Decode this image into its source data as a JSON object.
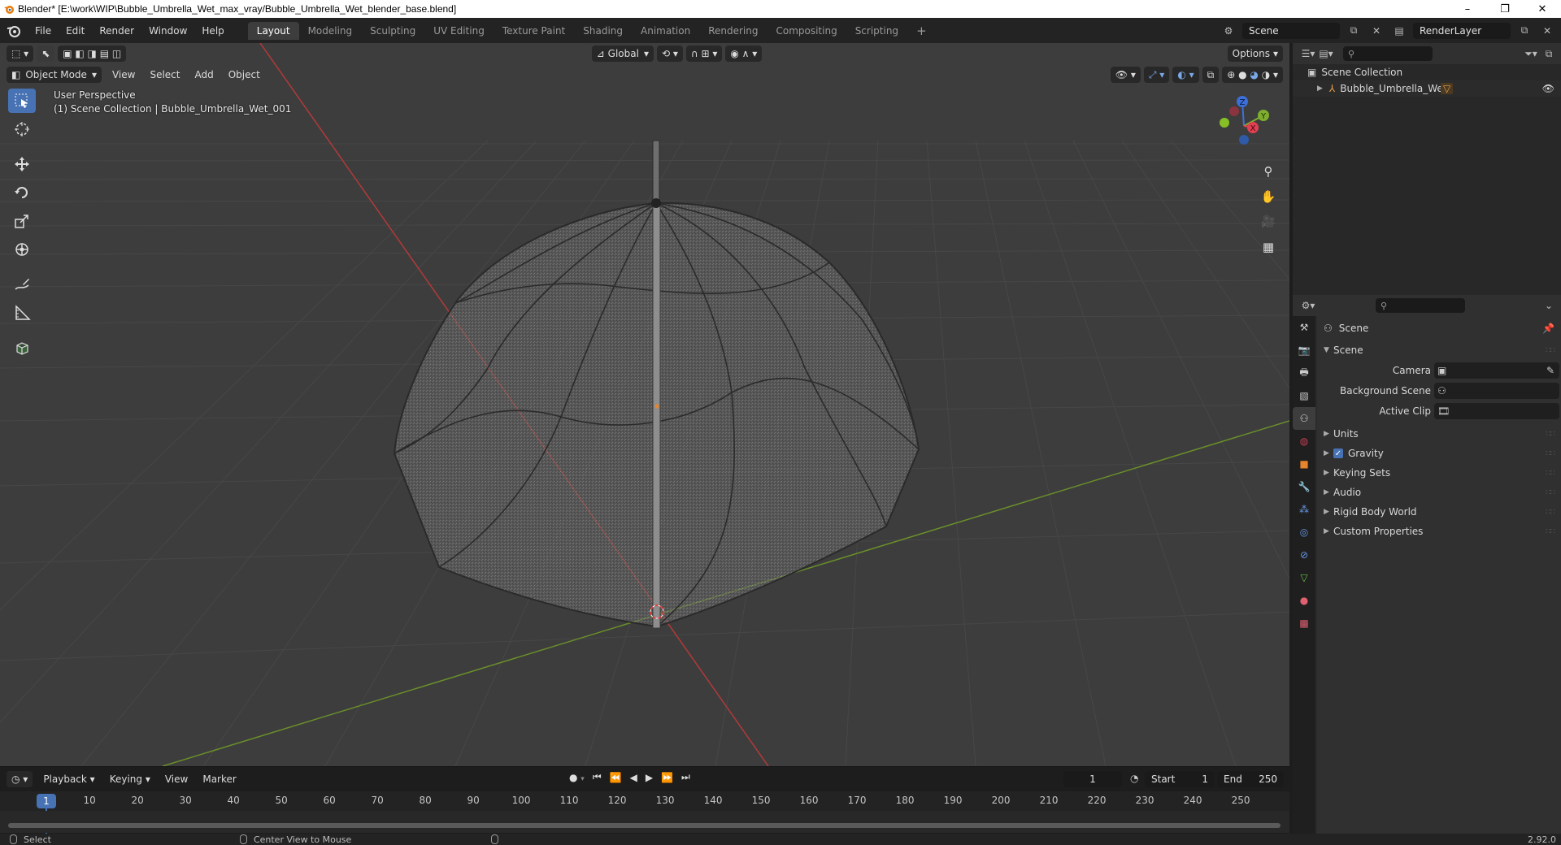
{
  "titlebar": {
    "title": "Blender* [E:\\work\\WIP\\Bubble_Umbrella_Wet_max_vray/Bubble_Umbrella_Wet_blender_base.blend]",
    "minimize": "–",
    "maximize": "❐",
    "close": "✕"
  },
  "menu": {
    "items": [
      "File",
      "Edit",
      "Render",
      "Window",
      "Help"
    ]
  },
  "workspaces": {
    "tabs": [
      "Layout",
      "Modeling",
      "Sculpting",
      "UV Editing",
      "Texture Paint",
      "Shading",
      "Animation",
      "Rendering",
      "Compositing",
      "Scripting"
    ],
    "active": "Layout",
    "add": "+"
  },
  "scene_selector": {
    "scene": "Scene",
    "view_layer": "RenderLayer"
  },
  "viewport": {
    "mode": "Object Mode",
    "menus": [
      "View",
      "Select",
      "Add",
      "Object"
    ],
    "transform_orientation": "Global",
    "options": "Options",
    "overlay_line1": "User Perspective",
    "overlay_line2": "(1) Scene Collection | Bubble_Umbrella_Wet_001",
    "gizmo": {
      "x": "X",
      "y": "Y",
      "z": "Z"
    },
    "colors": {
      "bg": "#3d3d3d",
      "grid": "#4a4a4a",
      "x_axis": "#b23a3a",
      "y_axis": "#6a8f2a",
      "active": "#4772b3"
    }
  },
  "tools": [
    "select-box",
    "cursor",
    "move",
    "rotate",
    "scale",
    "transform",
    "annotate",
    "measure",
    "add-cube"
  ],
  "timeline": {
    "menus": [
      "Playback",
      "Keying",
      "View",
      "Marker"
    ],
    "current_frame": "1",
    "start_label": "Start",
    "start": "1",
    "end_label": "End",
    "end": "250",
    "ticks": [
      "10",
      "20",
      "30",
      "40",
      "50",
      "60",
      "70",
      "80",
      "90",
      "100",
      "110",
      "120",
      "130",
      "140",
      "150",
      "160",
      "170",
      "180",
      "190",
      "200",
      "210",
      "220",
      "230",
      "240",
      "250"
    ],
    "ruler_current": "1"
  },
  "statusbar": {
    "select": "Select",
    "center": "Center View to Mouse",
    "version": "2.92.0"
  },
  "outliner": {
    "root": "Scene Collection",
    "items": [
      {
        "label": "Bubble_Umbrella_Wet"
      }
    ]
  },
  "properties": {
    "context": "Scene",
    "section": "Scene",
    "fields": [
      {
        "label": "Camera",
        "value": ""
      },
      {
        "label": "Background Scene",
        "value": ""
      },
      {
        "label": "Active Clip",
        "value": ""
      }
    ],
    "panels": [
      "Units",
      "Gravity",
      "Keying Sets",
      "Audio",
      "Rigid Body World",
      "Custom Properties"
    ],
    "gravity_checked": true
  }
}
